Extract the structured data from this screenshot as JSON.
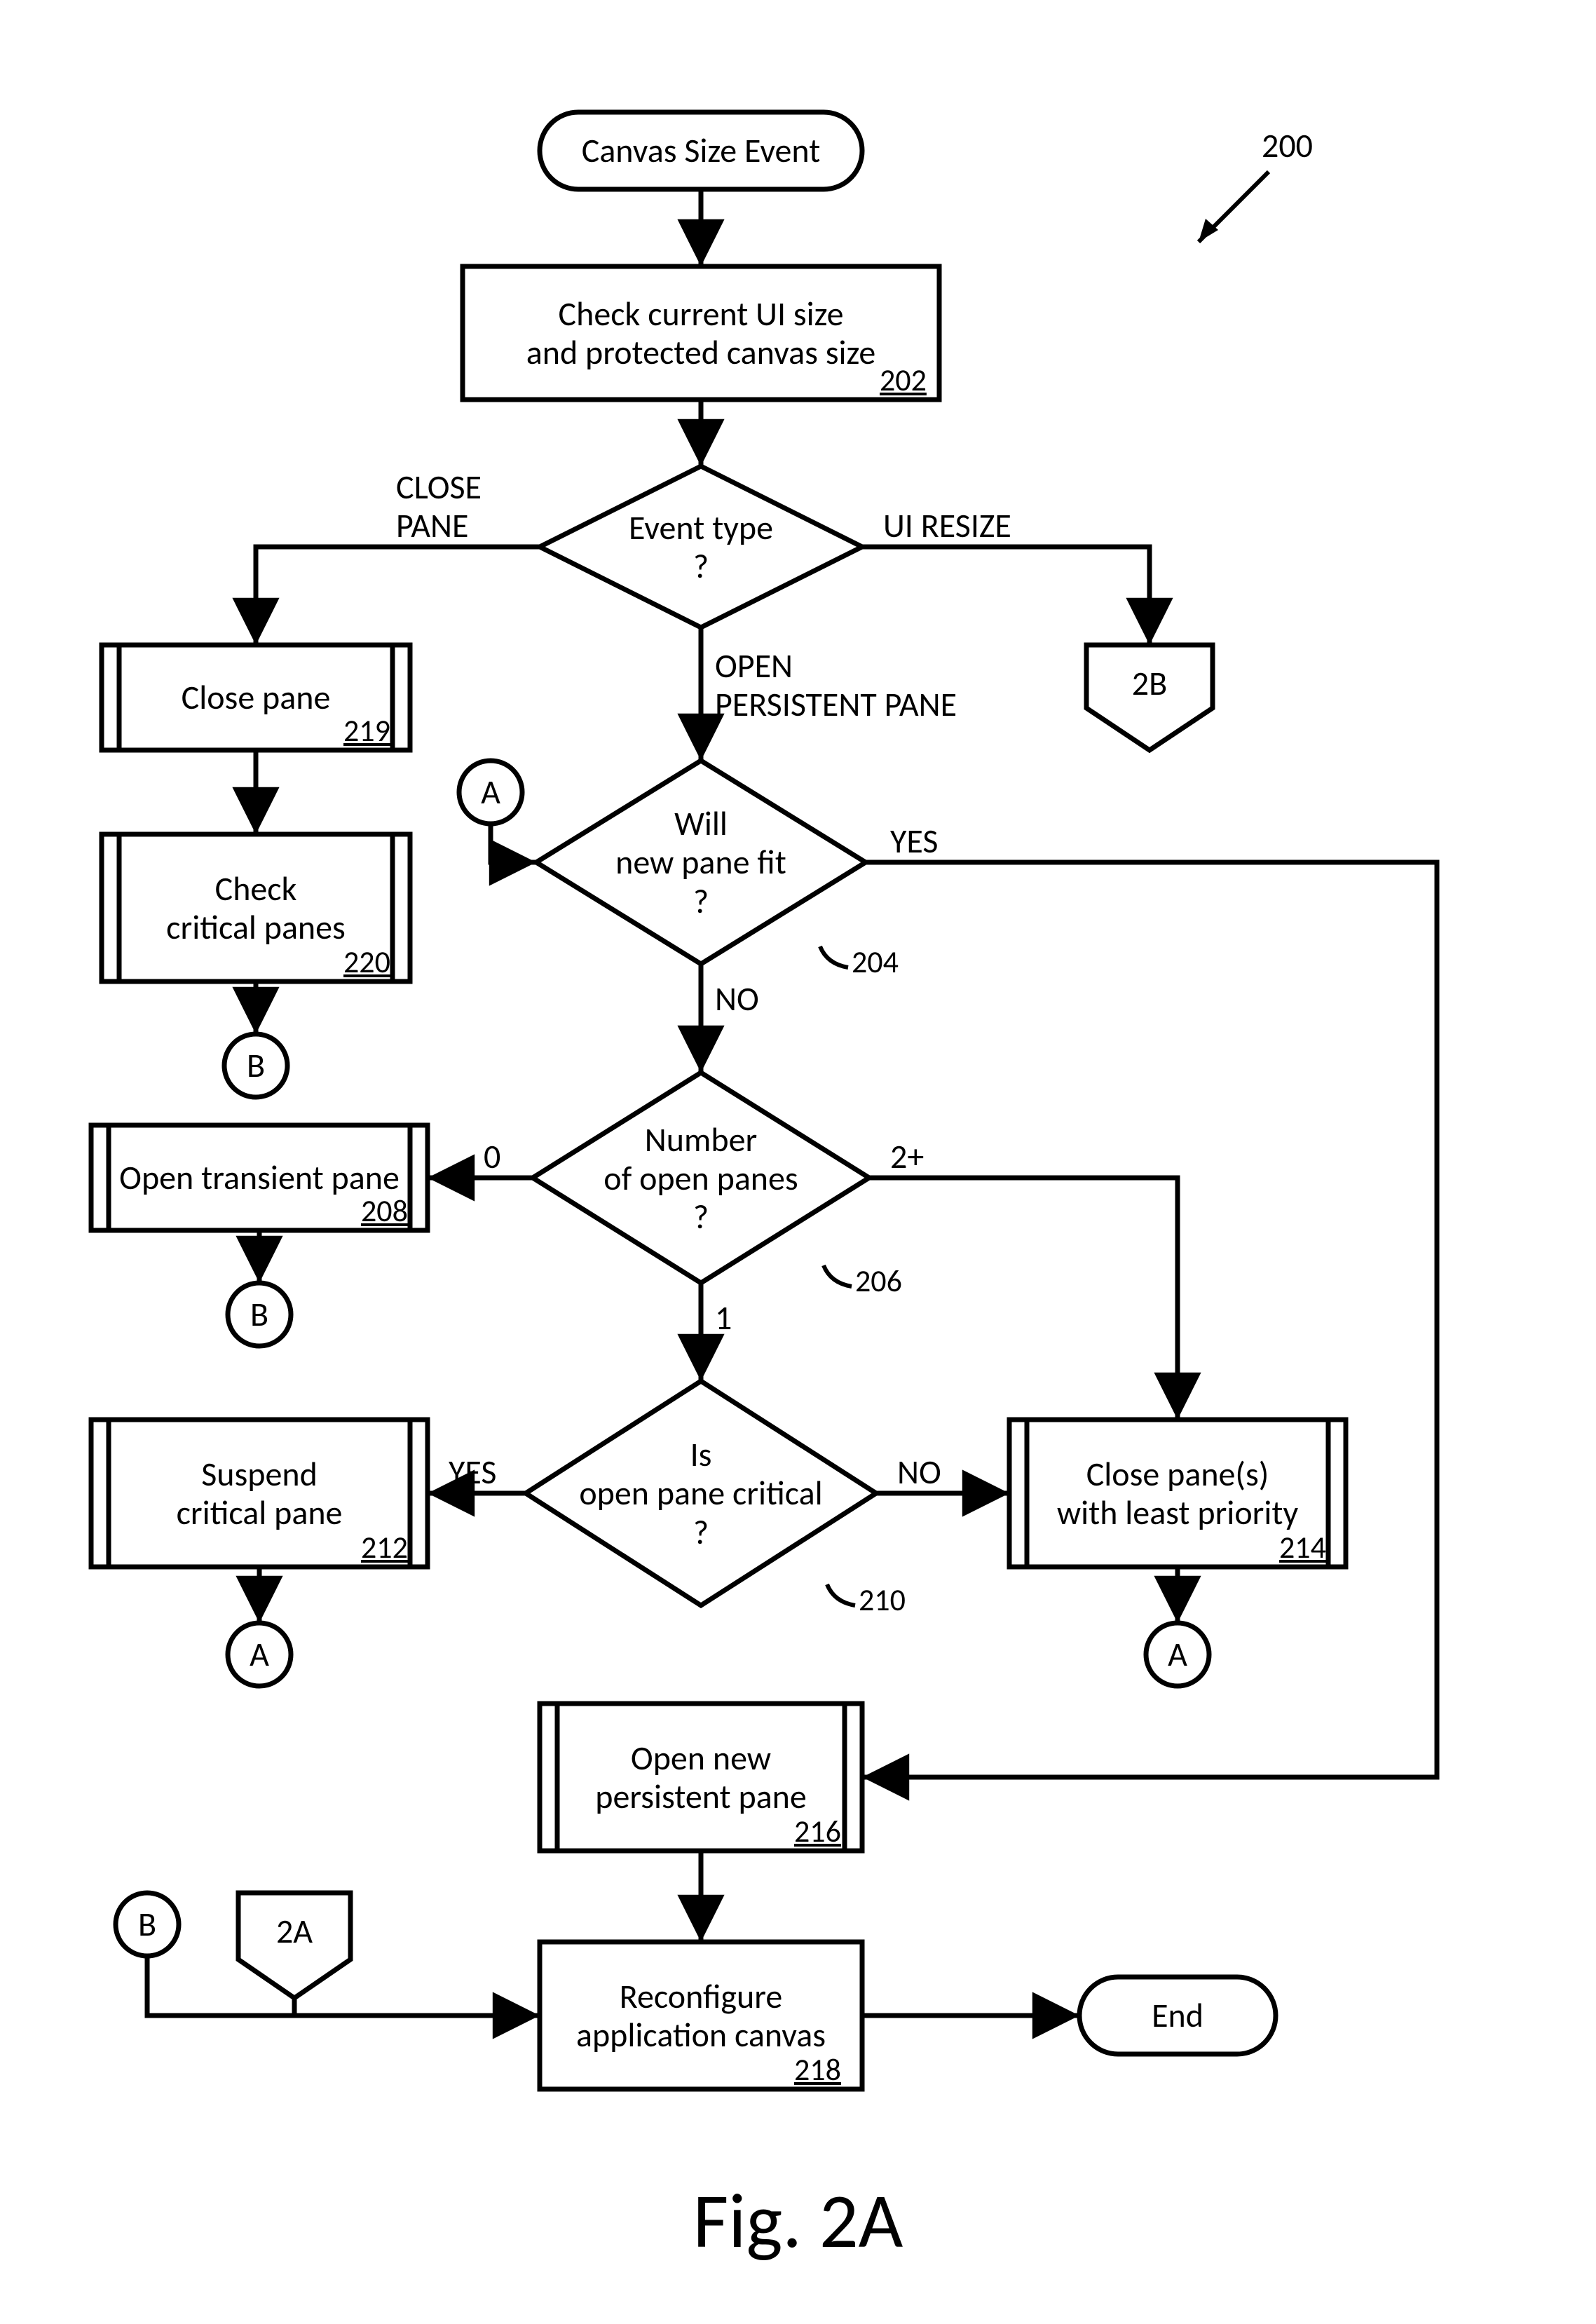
{
  "figure": {
    "caption": "Fig. 2A",
    "callout": "200"
  },
  "nodes": {
    "start": {
      "label": "Canvas Size Event"
    },
    "n202": {
      "line1": "Check current UI size",
      "line2": "and protected canvas size",
      "ref": "202"
    },
    "d_event": {
      "line1": "Event type",
      "line2": "?"
    },
    "n219": {
      "line1": "Close pane",
      "ref": "219"
    },
    "n220": {
      "line1": "Check",
      "line2": "critical panes",
      "ref": "220"
    },
    "d204": {
      "line1": "Will",
      "line2": "new pane fit",
      "line3": "?",
      "ref": "204"
    },
    "d206": {
      "line1": "Number",
      "line2": "of open panes",
      "line3": "?",
      "ref": "206"
    },
    "n208": {
      "line1": "Open transient pane",
      "ref": "208"
    },
    "d210": {
      "line1": "Is",
      "line2": "open pane critical",
      "line3": "?",
      "ref": "210"
    },
    "n212": {
      "line1": "Suspend",
      "line2": "critical pane",
      "ref": "212"
    },
    "n214": {
      "line1": "Close pane(s)",
      "line2": "with least priority",
      "ref": "214"
    },
    "n216": {
      "line1": "Open new",
      "line2": "persistent pane",
      "ref": "216"
    },
    "n218": {
      "line1": "Reconfigure",
      "line2": "application canvas",
      "ref": "218"
    },
    "end": {
      "label": "End"
    },
    "off_2b": {
      "label": "2B"
    },
    "off_2a": {
      "label": "2A"
    },
    "conn_a": {
      "label": "A"
    },
    "conn_b": {
      "label": "B"
    }
  },
  "edges": {
    "close_pane": {
      "l1": "CLOSE",
      "l2": "PANE"
    },
    "ui_resize": "UI RESIZE",
    "open_persist": {
      "l1": "OPEN",
      "l2": "PERSISTENT  PANE"
    },
    "yes": "YES",
    "no": "NO",
    "zero": "0",
    "one": "1",
    "two_plus": "2+"
  }
}
